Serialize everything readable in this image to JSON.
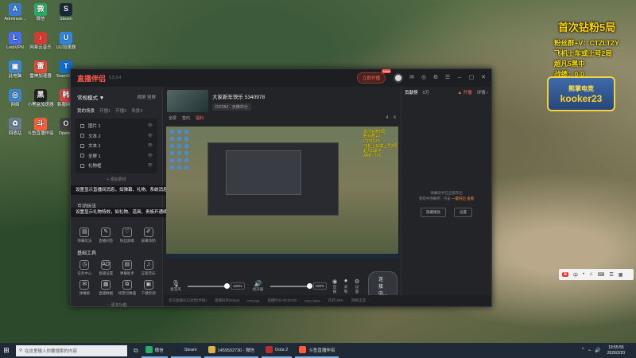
{
  "desktop": {
    "icons": [
      {
        "label": "Administr...",
        "color": "#3a7bd5",
        "glyph": "A"
      },
      {
        "label": "微信",
        "color": "#2aae67",
        "glyph": "微"
      },
      {
        "label": "Steam",
        "color": "#1b2838",
        "glyph": "S"
      },
      {
        "label": "LetsVPN",
        "color": "#4a6cf0",
        "glyph": "L"
      },
      {
        "label": "网易云音乐",
        "color": "#d33a31",
        "glyph": "♪"
      },
      {
        "label": "UU加速器",
        "color": "#2f86e0",
        "glyph": "U"
      },
      {
        "label": "此电脑",
        "color": "#3b8ad9",
        "glyph": "▣"
      },
      {
        "label": "雷神加速器",
        "color": "#e84a3a",
        "glyph": "雷"
      },
      {
        "label": "TeamView",
        "color": "#0e6ed4",
        "glyph": "T"
      },
      {
        "label": "网络",
        "color": "#3a86d0",
        "glyph": "◎"
      },
      {
        "label": "小黑盒加速器",
        "color": "#222",
        "glyph": "黑"
      },
      {
        "label": "韩服网络",
        "color": "#d44",
        "glyph": "韩"
      },
      {
        "label": "回收站",
        "color": "#6a7f94",
        "glyph": "♻"
      },
      {
        "label": "斗鱼直播伴侣",
        "color": "#ff5d3a",
        "glyph": "斗"
      },
      {
        "label": "Opener",
        "color": "#444",
        "glyph": "O"
      }
    ]
  },
  "overlay": {
    "title": "首次钻粉5局",
    "lines": [
      "粉丝群+V：CTZLTZY",
      "飞机上车或上号2局",
      "超凡5黑中",
      "战绩：0-0"
    ],
    "badge_top": "熊掌电竞",
    "badge_bottom": "kooker23"
  },
  "app": {
    "logo": "直播伴侣",
    "version": "5.5.3.4",
    "live_btn": "立即开播",
    "live_tag": "New",
    "mode": "常规模式 ▼",
    "mode_right": "横屏  竖屏",
    "scene_tabs": [
      "我的场景",
      "开播1",
      "开播2",
      "场景3"
    ],
    "sources": [
      {
        "name": "图片 1"
      },
      {
        "name": "文本 2"
      },
      {
        "name": "文本 1"
      },
      {
        "name": "全屏 1"
      },
      {
        "name": "礼物框"
      }
    ],
    "add_source": "+ 添加素材",
    "tooltip1": "设置显示直播间消息，如弹幕、礼物、系统消息、粉丝牌升级等",
    "tooltip2": "设置显示礼物特效，如礼物、道具、贵族开通续费、贴纸",
    "interact_title": "互动玩法",
    "play_tools": [
      {
        "label": "弹幕玩法",
        "glyph": "▤"
      },
      {
        "label": "直播间签",
        "glyph": "✎"
      },
      {
        "label": "粉丝勋章",
        "glyph": "♡"
      },
      {
        "label": "屏幕涂鸦",
        "glyph": "✐"
      }
    ],
    "base_title": "基础工具",
    "base_tools": [
      {
        "label": "任务中心",
        "glyph": "◷",
        "badge": ""
      },
      {
        "label": "直播设置",
        "glyph": "AD",
        "badge": "1"
      },
      {
        "label": "弹幕助手",
        "glyph": "▤",
        "badge": ""
      },
      {
        "label": "正版音乐",
        "glyph": "♫",
        "badge": ""
      },
      {
        "label": "弹幕姬",
        "glyph": "✉",
        "badge": ""
      },
      {
        "label": "直播数据",
        "glyph": "▦",
        "badge": ""
      },
      {
        "label": "场景切换器",
        "glyph": "⧉",
        "badge": ""
      },
      {
        "label": "下播检测",
        "glyph": "▣",
        "badge": ""
      }
    ],
    "more_tools": "⋯ 更多功能",
    "room_title": "大家新年快乐 5340978",
    "room_category": "DOTA2 · 天梯冲分",
    "room_actions": [
      "全屏",
      "签约",
      "福利",
      "4",
      "6"
    ],
    "mixer": {
      "mic_label": "麦克风",
      "mic_pct": "100%",
      "spk_label": "扬声器",
      "spk_pct": "100%",
      "ctrl": [
        {
          "label": "直播",
          "glyph": "◉"
        },
        {
          "label": "录制",
          "glyph": "⏺"
        },
        {
          "label": "设置",
          "glyph": "⚙"
        }
      ],
      "connect": "连接中..."
    },
    "status": [
      "您的直播间已封禁(举报)",
      "直播码率(Kbps)",
      "FPS:60",
      "直播时长:00:00:00",
      "CPU:29%",
      "内存:45%",
      "网络正常"
    ],
    "right_tabs": [
      "贡献榜",
      "0万"
    ],
    "right_hl": "▲ 开播",
    "right_detail": "详情 ›",
    "right_empty1": "弹幕助手已全部开启",
    "right_empty2": "游戏中弹幕用 · 点击",
    "right_empty_link": "一键开启",
    "right_empty3": "查看",
    "right_btns": [
      "隐藏播放",
      "设置"
    ]
  },
  "tray_mini": {
    "s": "S",
    "items": [
      "中",
      "•",
      "♫",
      "⌨",
      "☰",
      "▦"
    ]
  },
  "taskbar": {
    "search_placeholder": "在这里输入你要搜索的内容",
    "apps": [
      {
        "label": "微信",
        "color": "#2aae67"
      },
      {
        "label": "Steam",
        "color": "#1b2838"
      },
      {
        "label": "1459502730 - 微信",
        "color": "#d8b44a"
      },
      {
        "label": "Dota 2",
        "color": "#b5302a"
      },
      {
        "label": "斗鱼直播伴侣",
        "color": "#ff5d3a"
      }
    ],
    "time": "19:55:55",
    "date": "2026/2/20"
  }
}
